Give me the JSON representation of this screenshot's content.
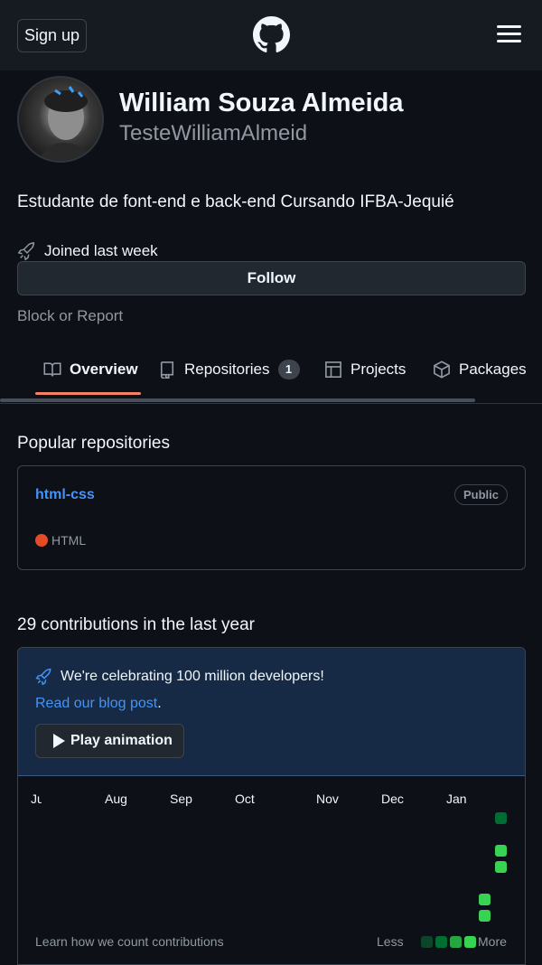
{
  "header": {
    "signup_label": "Sign up",
    "logo_icon": "github-mark-icon",
    "menu_icon": "hamburger-menu-icon"
  },
  "profile": {
    "name": "William Souza Almeida",
    "login": "TesteWilliamAlmeid",
    "bio": "Estudante de font-end e back-end Cursando IFBA-Jequié",
    "joined": "Joined last week",
    "follow_label": "Follow",
    "block_report": "Block or Report"
  },
  "tabs": [
    {
      "label": "Overview",
      "icon": "book-icon",
      "selected": true
    },
    {
      "label": "Repositories",
      "icon": "repo-icon",
      "count": "1"
    },
    {
      "label": "Projects",
      "icon": "table-icon"
    },
    {
      "label": "Packages",
      "icon": "package-icon"
    }
  ],
  "popular": {
    "title": "Popular repositories",
    "repos": [
      {
        "name": "html-css",
        "visibility": "Public",
        "language": "HTML",
        "language_color": "#e34c26"
      }
    ]
  },
  "contributions": {
    "title": "29 contributions in the last year",
    "promo_text": "We're celebrating 100 million developers!",
    "promo_link": "Read our blog post",
    "promo_period": ".",
    "play_label": "Play animation",
    "months": [
      "Jul",
      "Aug",
      "Sep",
      "Oct",
      "Nov",
      "Dec",
      "Jan"
    ],
    "learn": "Learn how we count contributions",
    "legend_less": "Less",
    "legend_more": "More",
    "colors": [
      "#0e4429",
      "#006d32",
      "#26a641",
      "#39d353"
    ]
  }
}
